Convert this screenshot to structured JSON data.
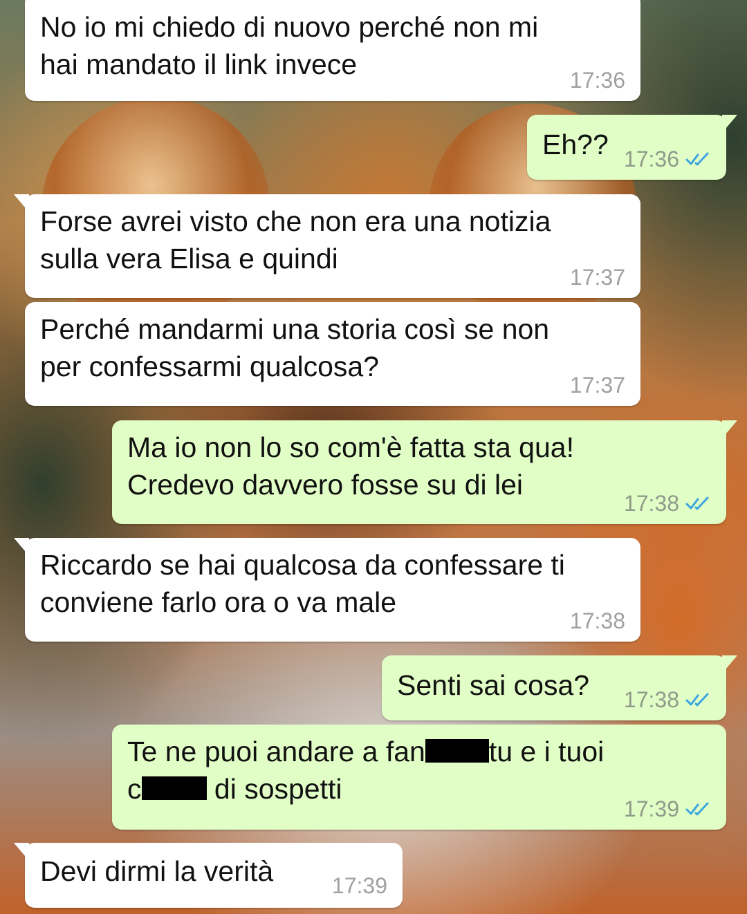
{
  "colors": {
    "incoming_bubble": "#ffffff",
    "outgoing_bubble": "#e1fec6",
    "read_ticks": "#3ba5e0",
    "timestamp": "#a0a0a0"
  },
  "messages": [
    {
      "direction": "in",
      "lines": [
        "No io mi chiedo di nuovo perché non mi",
        "hai mandato il link invece"
      ],
      "time": "17:36"
    },
    {
      "direction": "out",
      "lines": [
        "Eh??"
      ],
      "time": "17:36",
      "status_icon": "double-check-read-icon"
    },
    {
      "direction": "in",
      "lines": [
        "Forse avrei visto che non era una notizia",
        "sulla vera Elisa e quindi"
      ],
      "time": "17:37"
    },
    {
      "direction": "in",
      "lines": [
        "Perché mandarmi una storia così se non",
        "per confessarmi qualcosa?"
      ],
      "time": "17:37"
    },
    {
      "direction": "out",
      "lines": [
        "Ma io non lo so com'è fatta sta qua!",
        "Credevo davvero fosse su di lei"
      ],
      "time": "17:38",
      "status_icon": "double-check-read-icon"
    },
    {
      "direction": "in",
      "lines": [
        "Riccardo se hai qualcosa da confessare ti",
        "conviene farlo ora o va male"
      ],
      "time": "17:38"
    },
    {
      "direction": "out",
      "lines": [
        "Senti sai cosa?"
      ],
      "time": "17:38",
      "status_icon": "double-check-read-icon"
    },
    {
      "direction": "out",
      "parts": {
        "l1a": "Te ne puoi andare a fan",
        "l1b": "tu e i tuoi",
        "l2a": "c",
        "l2b": " di sospetti"
      },
      "time": "17:39",
      "status_icon": "double-check-read-icon"
    },
    {
      "direction": "in",
      "lines": [
        "Devi dirmi la verità"
      ],
      "time": "17:39"
    }
  ]
}
